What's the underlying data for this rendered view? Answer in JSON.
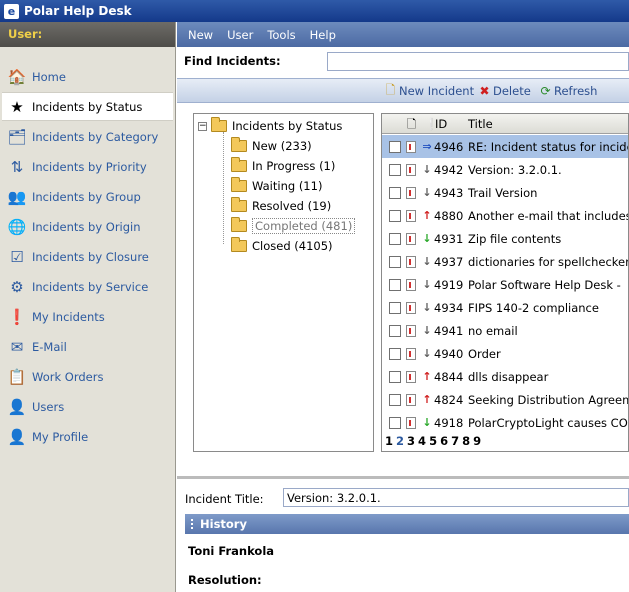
{
  "window": {
    "title": "Polar Help Desk"
  },
  "sidebar": {
    "user_label": "User:",
    "items": [
      {
        "label": "Home",
        "icon": "home-icon",
        "glyph": "🏠",
        "active": false
      },
      {
        "label": "Incidents by Status",
        "icon": "star-icon",
        "glyph": "★",
        "active": true
      },
      {
        "label": "Incidents by Category",
        "icon": "folder-icon",
        "glyph": "🗂",
        "active": false
      },
      {
        "label": "Incidents by Priority",
        "icon": "priority-arrows-icon",
        "glyph": "⇅",
        "active": false
      },
      {
        "label": "Incidents by Group",
        "icon": "group-icon",
        "glyph": "👥",
        "active": false
      },
      {
        "label": "Incidents by Origin",
        "icon": "globe-icon",
        "glyph": "🌐",
        "active": false
      },
      {
        "label": "Incidents by Closure",
        "icon": "checkbox-icon",
        "glyph": "☑",
        "active": false
      },
      {
        "label": "Incidents by Service",
        "icon": "gear-icon",
        "glyph": "⚙",
        "active": false
      },
      {
        "label": "My Incidents",
        "icon": "exclamation-icon",
        "glyph": "❗",
        "active": false
      },
      {
        "label": "E-Mail",
        "icon": "mail-icon",
        "glyph": "✉",
        "active": false
      },
      {
        "label": "Work Orders",
        "icon": "work-order-icon",
        "glyph": "📋",
        "active": false
      },
      {
        "label": "Users",
        "icon": "user-icon",
        "glyph": "👤",
        "active": false
      },
      {
        "label": "My Profile",
        "icon": "profile-icon",
        "glyph": "👤",
        "active": false
      }
    ]
  },
  "menu": {
    "items": [
      "New",
      "User",
      "Tools",
      "Help"
    ]
  },
  "find": {
    "label": "Find Incidents:",
    "value": ""
  },
  "toolbar": {
    "new_incident": "New Incident",
    "delete": "Delete",
    "refresh": "Refresh"
  },
  "tree": {
    "root": "Incidents by Status",
    "toggle": "−",
    "children": [
      {
        "label": "New (233)",
        "selected": false
      },
      {
        "label": "In Progress (1)",
        "selected": false
      },
      {
        "label": "Waiting (11)",
        "selected": false
      },
      {
        "label": "Resolved (19)",
        "selected": false
      },
      {
        "label": "Completed (481)",
        "selected": true
      },
      {
        "label": "Closed (4105)",
        "selected": false
      }
    ]
  },
  "grid": {
    "headers": {
      "id": "ID",
      "title": "Title"
    },
    "rows": [
      {
        "id": "4946",
        "title": "RE: Incident status for incide",
        "priority": "right",
        "selected": true
      },
      {
        "id": "4942",
        "title": "Version: 3.2.0.1.",
        "priority": "down",
        "selected": false
      },
      {
        "id": "4943",
        "title": "Trail Version",
        "priority": "down",
        "selected": false
      },
      {
        "id": "4880",
        "title": "Another e-mail that includes",
        "priority": "up",
        "selected": false
      },
      {
        "id": "4931",
        "title": "Zip file contents",
        "priority": "green",
        "selected": false
      },
      {
        "id": "4937",
        "title": "dictionaries for spellchecker",
        "priority": "down",
        "selected": false
      },
      {
        "id": "4919",
        "title": "Polar Software Help Desk -",
        "priority": "down",
        "selected": false
      },
      {
        "id": "4934",
        "title": "FIPS 140-2 compliance",
        "priority": "down",
        "selected": false
      },
      {
        "id": "4941",
        "title": "no email",
        "priority": "down",
        "selected": false
      },
      {
        "id": "4940",
        "title": "Order",
        "priority": "down",
        "selected": false
      },
      {
        "id": "4844",
        "title": "dlls disappear",
        "priority": "up",
        "selected": false
      },
      {
        "id": "4824",
        "title": "Seeking Distribution Agreem",
        "priority": "up",
        "selected": false
      },
      {
        "id": "4918",
        "title": "PolarCryptoLight causes CO",
        "priority": "green",
        "selected": false
      }
    ],
    "pages": [
      "1",
      "2",
      "3",
      "4",
      "5",
      "6",
      "7",
      "8",
      "9"
    ],
    "current_page": "2"
  },
  "detail": {
    "incident_title_label": "Incident Title:",
    "incident_title_value": "Version: 3.2.0.1.",
    "history_label": "History",
    "author": "Toni Frankola",
    "resolution_label": "Resolution:"
  }
}
